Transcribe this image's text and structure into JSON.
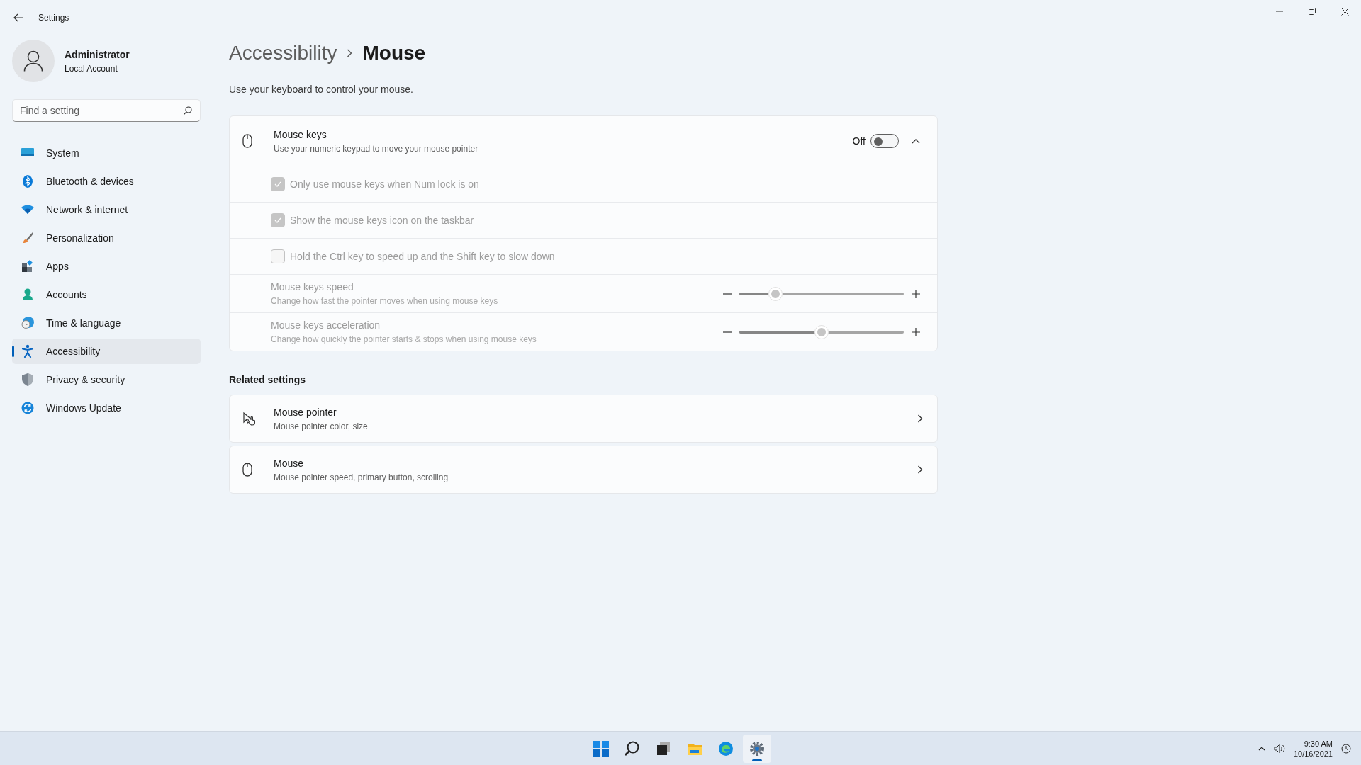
{
  "window": {
    "title": "Settings"
  },
  "user": {
    "name": "Administrator",
    "account": "Local Account"
  },
  "search": {
    "placeholder": "Find a setting"
  },
  "sidebar": {
    "items": [
      {
        "label": "System",
        "selected": false
      },
      {
        "label": "Bluetooth & devices",
        "selected": false
      },
      {
        "label": "Network & internet",
        "selected": false
      },
      {
        "label": "Personalization",
        "selected": false
      },
      {
        "label": "Apps",
        "selected": false
      },
      {
        "label": "Accounts",
        "selected": false
      },
      {
        "label": "Time & language",
        "selected": false
      },
      {
        "label": "Accessibility",
        "selected": true
      },
      {
        "label": "Privacy & security",
        "selected": false
      },
      {
        "label": "Windows Update",
        "selected": false
      }
    ]
  },
  "breadcrumb": {
    "parent": "Accessibility",
    "current": "Mouse"
  },
  "description": "Use your keyboard to control your mouse.",
  "mouse_keys": {
    "title": "Mouse keys",
    "subtitle": "Use your numeric keypad to move your mouse pointer",
    "state_label": "Off",
    "on": false,
    "expanded": true,
    "options": [
      {
        "kind": "checkbox",
        "label": "Only use mouse keys when Num lock is on",
        "checked": true,
        "disabled": true
      },
      {
        "kind": "checkbox",
        "label": "Show the mouse keys icon on the taskbar",
        "checked": true,
        "disabled": true
      },
      {
        "kind": "checkbox",
        "label": "Hold the Ctrl key to speed up and the Shift key to slow down",
        "checked": false,
        "disabled": true
      },
      {
        "kind": "slider",
        "title": "Mouse keys speed",
        "subtitle": "Change how fast the pointer moves when using mouse keys",
        "level": 0.22,
        "disabled": true
      },
      {
        "kind": "slider",
        "title": "Mouse keys acceleration",
        "subtitle": "Change how quickly the pointer starts & stops when using mouse keys",
        "level": 0.5,
        "disabled": true
      }
    ]
  },
  "related": {
    "heading": "Related settings",
    "items": [
      {
        "title": "Mouse pointer",
        "subtitle": "Mouse pointer color, size"
      },
      {
        "title": "Mouse",
        "subtitle": "Mouse pointer speed, primary button, scrolling"
      }
    ]
  },
  "taskbar": {
    "apps": [
      {
        "selected": false
      },
      {
        "selected": false
      },
      {
        "selected": false
      },
      {
        "selected": false
      },
      {
        "selected": false
      },
      {
        "selected": true
      }
    ],
    "clock": {
      "time": "9:30 AM",
      "date": "10/16/2021"
    }
  }
}
